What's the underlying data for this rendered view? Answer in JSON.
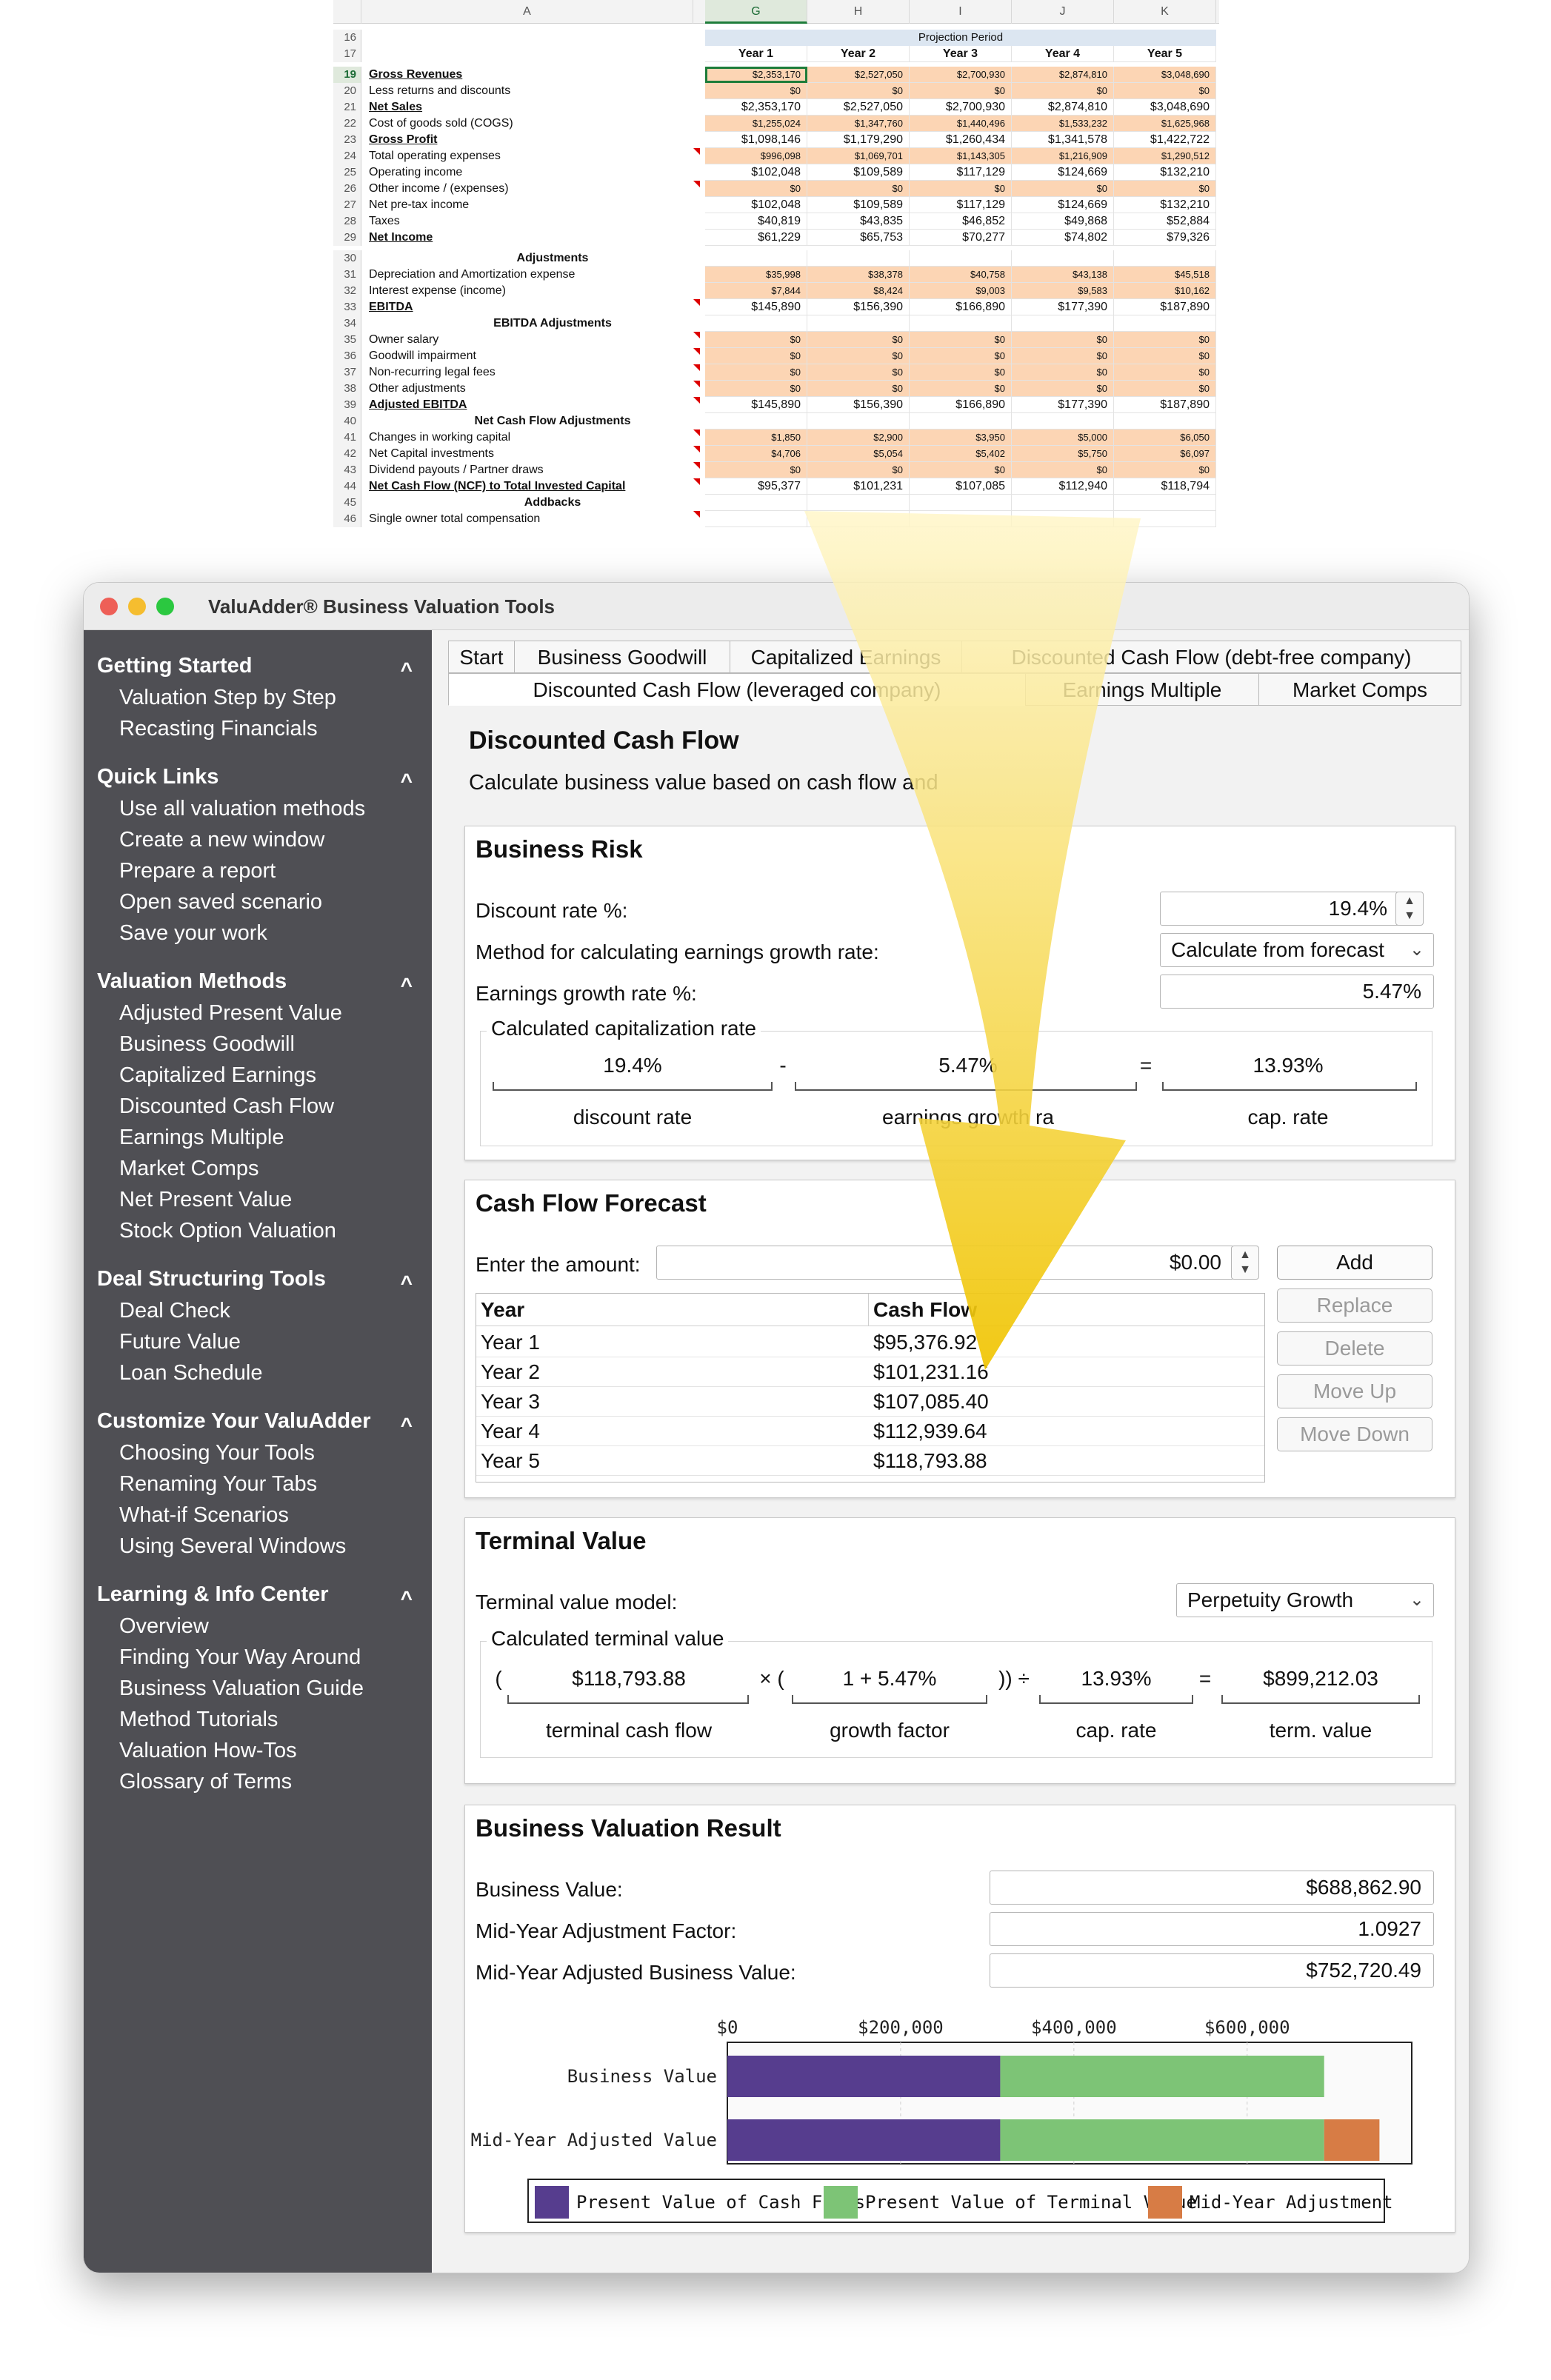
{
  "spreadsheet": {
    "columns": [
      "A",
      "G",
      "H",
      "I",
      "J",
      "K"
    ],
    "projection_title": "Projection Period",
    "year_headers": [
      "Year 1",
      "Year 2",
      "Year 3",
      "Year 4",
      "Year 5"
    ],
    "rows": [
      {
        "n": "16",
        "label": "",
        "vals": [
          "",
          "",
          "",
          "",
          ""
        ]
      },
      {
        "n": "17",
        "label": "",
        "vals": [
          "Year 1",
          "Year 2",
          "Year 3",
          "Year 4",
          "Year 5"
        ]
      },
      {
        "n": "19",
        "label": "Gross Revenues",
        "vals": [
          "$2,353,170",
          "$2,527,050",
          "$2,700,930",
          "$2,874,810",
          "$3,048,690"
        ]
      },
      {
        "n": "20",
        "label": "Less returns and discounts",
        "vals": [
          "$0",
          "$0",
          "$0",
          "$0",
          "$0"
        ]
      },
      {
        "n": "21",
        "label": "Net Sales",
        "vals": [
          "$2,353,170",
          "$2,527,050",
          "$2,700,930",
          "$2,874,810",
          "$3,048,690"
        ]
      },
      {
        "n": "22",
        "label": "Cost of goods sold (COGS)",
        "vals": [
          "$1,255,024",
          "$1,347,760",
          "$1,440,496",
          "$1,533,232",
          "$1,625,968"
        ]
      },
      {
        "n": "23",
        "label": "Gross Profit",
        "vals": [
          "$1,098,146",
          "$1,179,290",
          "$1,260,434",
          "$1,341,578",
          "$1,422,722"
        ]
      },
      {
        "n": "24",
        "label": "Total operating expenses",
        "vals": [
          "$996,098",
          "$1,069,701",
          "$1,143,305",
          "$1,216,909",
          "$1,290,512"
        ]
      },
      {
        "n": "25",
        "label": "Operating income",
        "vals": [
          "$102,048",
          "$109,589",
          "$117,129",
          "$124,669",
          "$132,210"
        ]
      },
      {
        "n": "26",
        "label": "Other income / (expenses)",
        "vals": [
          "$0",
          "$0",
          "$0",
          "$0",
          "$0"
        ]
      },
      {
        "n": "27",
        "label": "Net pre-tax income",
        "vals": [
          "$102,048",
          "$109,589",
          "$117,129",
          "$124,669",
          "$132,210"
        ]
      },
      {
        "n": "28",
        "label": "Taxes",
        "vals": [
          "$40,819",
          "$43,835",
          "$46,852",
          "$49,868",
          "$52,884"
        ]
      },
      {
        "n": "29",
        "label": "Net Income",
        "vals": [
          "$61,229",
          "$65,753",
          "$70,277",
          "$74,802",
          "$79,326"
        ]
      },
      {
        "n": "30",
        "label": "Adjustments",
        "vals": [
          "",
          "",
          "",
          "",
          ""
        ]
      },
      {
        "n": "31",
        "label": "Depreciation and Amortization expense",
        "vals": [
          "$35,998",
          "$38,378",
          "$40,758",
          "$43,138",
          "$45,518"
        ]
      },
      {
        "n": "32",
        "label": "Interest expense (income)",
        "vals": [
          "$7,844",
          "$8,424",
          "$9,003",
          "$9,583",
          "$10,162"
        ]
      },
      {
        "n": "33",
        "label": "EBITDA",
        "vals": [
          "$145,890",
          "$156,390",
          "$166,890",
          "$177,390",
          "$187,890"
        ]
      },
      {
        "n": "34",
        "label": "EBITDA Adjustments",
        "vals": [
          "",
          "",
          "",
          "",
          ""
        ]
      },
      {
        "n": "35",
        "label": "Owner salary",
        "vals": [
          "$0",
          "$0",
          "$0",
          "$0",
          "$0"
        ]
      },
      {
        "n": "36",
        "label": "Goodwill impairment",
        "vals": [
          "$0",
          "$0",
          "$0",
          "$0",
          "$0"
        ]
      },
      {
        "n": "37",
        "label": "Non-recurring legal fees",
        "vals": [
          "$0",
          "$0",
          "$0",
          "$0",
          "$0"
        ]
      },
      {
        "n": "38",
        "label": "Other adjustments",
        "vals": [
          "$0",
          "$0",
          "$0",
          "$0",
          "$0"
        ]
      },
      {
        "n": "39",
        "label": "Adjusted EBITDA",
        "vals": [
          "$145,890",
          "$156,390",
          "$166,890",
          "$177,390",
          "$187,890"
        ]
      },
      {
        "n": "40",
        "label": "Net Cash Flow Adjustments",
        "vals": [
          "",
          "",
          "",
          "",
          ""
        ]
      },
      {
        "n": "41",
        "label": "Changes in working capital",
        "vals": [
          "$1,850",
          "$2,900",
          "$3,950",
          "$5,000",
          "$6,050"
        ]
      },
      {
        "n": "42",
        "label": "Net Capital investments",
        "vals": [
          "$4,706",
          "$5,054",
          "$5,402",
          "$5,750",
          "$6,097"
        ]
      },
      {
        "n": "43",
        "label": "Dividend payouts / Partner draws",
        "vals": [
          "$0",
          "$0",
          "$0",
          "$0",
          "$0"
        ]
      },
      {
        "n": "44",
        "label": "Net Cash Flow (NCF) to Total Invested Capital",
        "vals": [
          "$95,377",
          "$101,231",
          "$107,085",
          "$112,940",
          "$118,794"
        ]
      },
      {
        "n": "45",
        "label": "Addbacks",
        "vals": [
          "",
          "",
          "",
          "",
          ""
        ]
      },
      {
        "n": "46",
        "label": "Single owner total compensation",
        "vals": [
          "",
          "",
          "",
          "",
          ""
        ]
      }
    ]
  },
  "window": {
    "title": "ValuAdder® Business Valuation Tools"
  },
  "sidebar": {
    "sections": [
      {
        "title": "Getting Started",
        "items": [
          "Valuation Step by Step",
          "Recasting Financials"
        ]
      },
      {
        "title": "Quick Links",
        "items": [
          "Use all valuation methods",
          "Create a new window",
          "Prepare a report",
          "Open saved scenario",
          "Save your work"
        ]
      },
      {
        "title": "Valuation Methods",
        "items": [
          "Adjusted Present Value",
          "Business Goodwill",
          "Capitalized Earnings",
          "Discounted Cash Flow",
          "Earnings Multiple",
          "Market Comps",
          "Net Present Value",
          "Stock Option Valuation"
        ]
      },
      {
        "title": "Deal Structuring Tools",
        "items": [
          "Deal Check",
          "Future Value",
          "Loan Schedule"
        ]
      },
      {
        "title": "Customize Your ValuAdder",
        "items": [
          "Choosing Your Tools",
          "Renaming Your Tabs",
          "What-if Scenarios",
          "Using Several Windows"
        ]
      },
      {
        "title": "Learning & Info Center",
        "items": [
          "Overview",
          "Finding Your Way Around",
          "Business Valuation Guide",
          "Method Tutorials",
          "Valuation How-Tos",
          "Glossary of Terms"
        ]
      }
    ]
  },
  "tabs": {
    "row1": [
      "Start",
      "Business Goodwill",
      "Capitalized Earnings",
      "Discounted Cash Flow (debt-free company)"
    ],
    "row2": [
      "Discounted Cash Flow (leveraged company)",
      "Earnings Multiple",
      "Market Comps"
    ]
  },
  "page": {
    "title": "Discounted Cash Flow",
    "subtitle": "Calculate business value based on cash flow and"
  },
  "risk": {
    "title": "Business Risk",
    "discount_label": "Discount rate %:",
    "discount_value": "19.4%",
    "method_label": "Method for calculating earnings growth rate:",
    "method_value": "Calculate from forecast",
    "growth_label": "Earnings growth rate %:",
    "growth_value": "5.47%",
    "cap_group": "Calculated capitalization rate",
    "cap_a": "19.4%",
    "cap_op1": "-",
    "cap_b": "5.47%",
    "cap_op2": "=",
    "cap_c": "13.93%",
    "cap_a_label": "discount rate",
    "cap_b_label": "earnings growth ra",
    "cap_c_label": "cap. rate"
  },
  "forecast": {
    "title": "Cash Flow Forecast",
    "amount_label": "Enter the amount:",
    "amount_value": "$0.00",
    "buttons": {
      "add": "Add",
      "replace": "Replace",
      "delete": "Delete",
      "move_up": "Move Up",
      "move_down": "Move Down"
    },
    "col_year": "Year",
    "col_cash": "Cash Flow",
    "rows": [
      {
        "year": "Year 1",
        "cash": "$95,376.92"
      },
      {
        "year": "Year 2",
        "cash": "$101,231.16"
      },
      {
        "year": "Year 3",
        "cash": "$107,085.40"
      },
      {
        "year": "Year 4",
        "cash": "$112,939.64"
      },
      {
        "year": "Year 5",
        "cash": "$118,793.88"
      }
    ]
  },
  "terminal": {
    "title": "Terminal Value",
    "model_label": "Terminal value model:",
    "model_value": "Perpetuity Growth",
    "group": "Calculated terminal value",
    "open1": "(",
    "cash": "$118,793.88",
    "op1": "× (",
    "growth": "1 + 5.47%",
    "op2": ")) ÷",
    "cap": "13.93%",
    "op3": "=",
    "value": "$899,212.03",
    "cash_label": "terminal cash flow",
    "growth_label": "growth factor",
    "cap_label": "cap. rate",
    "value_label": "term. value"
  },
  "result": {
    "title": "Business Valuation Result",
    "bv_label": "Business Value:",
    "bv_value": "$688,862.90",
    "myf_label": "Mid-Year Adjustment Factor:",
    "myf_value": "1.0927",
    "myb_label": "Mid-Year Adjusted Business Value:",
    "myb_value": "$752,720.49"
  },
  "colors": {
    "pv_cash": "#563d8e",
    "pv_terminal": "#7dc476",
    "mid_year": "#d77c45",
    "sheet_orange": "#fcd5b4",
    "arrow_yellow": "#f2c500"
  },
  "chart_data": {
    "type": "bar",
    "orientation": "horizontal",
    "stacked": true,
    "categories": [
      "Business Value",
      "Mid-Year Adjusted Value"
    ],
    "series": [
      {
        "name": "Present Value of Cash Flows",
        "values": [
          315000,
          315000
        ]
      },
      {
        "name": "Present Value of Terminal Value",
        "values": [
          373863,
          373863
        ]
      },
      {
        "name": "Mid-Year Adjustment",
        "values": [
          0,
          63858
        ]
      }
    ],
    "x_ticks": [
      "$0",
      "$200,000",
      "$400,000",
      "$600,000"
    ],
    "xlim": [
      0,
      790000
    ],
    "grid": true,
    "legend_placement": "bottom"
  }
}
